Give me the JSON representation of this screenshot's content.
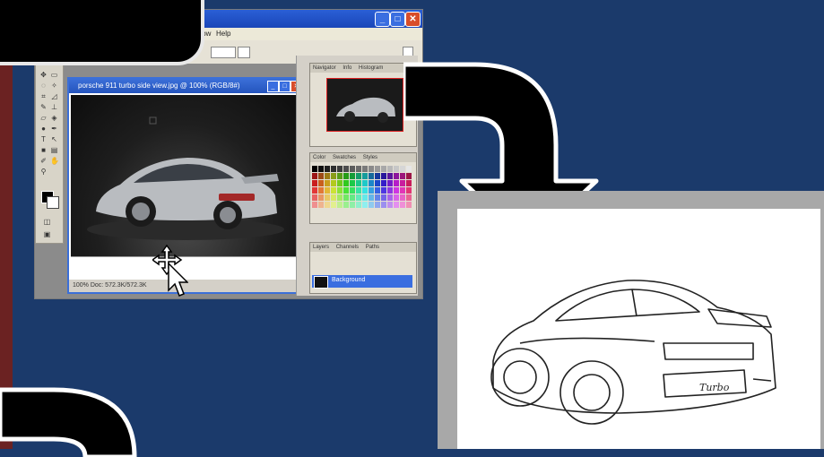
{
  "photoshop": {
    "menu": [
      "Window",
      "Help"
    ],
    "options_bar": {
      "size_value": "",
      "fit_text": "",
      "show_menu": ""
    },
    "document": {
      "title": "porsche 911 turbo side view.jpg @ 100% (RGB/8#)",
      "status": "100%   Doc: 572.3K/572.3K"
    },
    "panels": {
      "navigator_tabs": [
        "Navigator",
        "Info",
        "Histogram"
      ],
      "color_tabs": [
        "Color",
        "Swatches",
        "Styles"
      ],
      "layers_tabs": [
        "Layers",
        "Channels",
        "Paths"
      ],
      "layer_name": "Background"
    }
  },
  "sketch": {
    "plate_text": "Turbo"
  },
  "colors": {
    "background": "#1b3a6b",
    "accent_strip": "#6b2222",
    "arrow_fill": "#000000",
    "arrow_outline": "#ffffff"
  },
  "icons": [
    "move-cursor-icon",
    "arrow-pointer-icon",
    "curved-arrow-icon"
  ]
}
